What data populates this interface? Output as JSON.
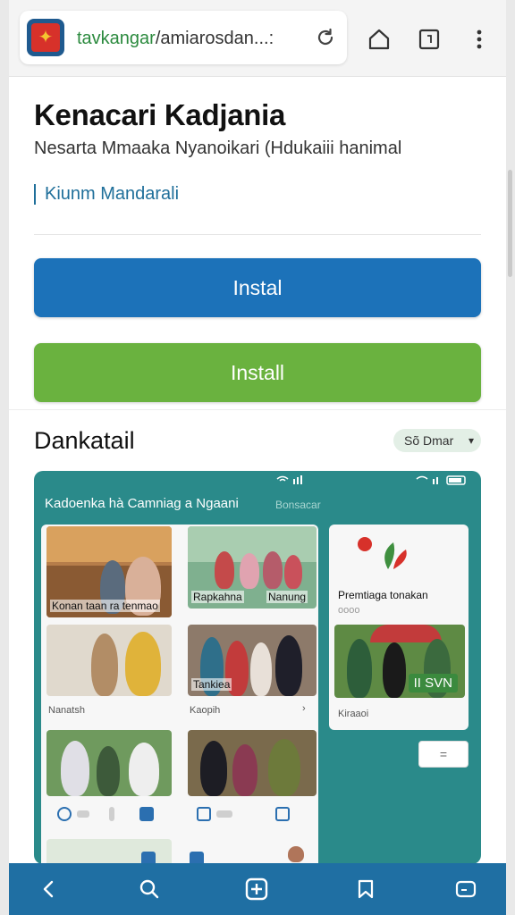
{
  "browser": {
    "url_host": "tavkangar",
    "url_path": "/amiarosdan...:",
    "icons": [
      "site-logo",
      "reload-icon",
      "home-icon",
      "tab-switcher-icon",
      "more-vertical-icon"
    ]
  },
  "page": {
    "title": "Kenacari Kadjania",
    "subtitle": "Nesarta Mmaaka Nyanoikari (Hdukaiii hanimal",
    "author": "Kiunm Mandarali"
  },
  "buttons": {
    "primary_label": "Instal",
    "secondary_label": "Install"
  },
  "section": {
    "title": "Dankatail",
    "pill_label": "Sõ Dmar",
    "pill_icon": "chevron-down-icon"
  },
  "preview": {
    "title": "Kadoenka hà Camniag a Ngaani",
    "sub": "Bonsacar",
    "tile_labels": [
      "Konan taan ra tenmao",
      "Rapkahna",
      "Nanung",
      "Tankiea",
      "Premtiaga tonakan"
    ],
    "captions": [
      "Nanatsh",
      "Kaopih",
      "Kiraaoi",
      "oooo"
    ],
    "badge": "II SVN",
    "side_button_icon": "equals-icon"
  },
  "bottom_nav": {
    "icons": [
      "back-icon",
      "search-icon",
      "add-tab-icon",
      "bookmark-icon",
      "tabs-icon"
    ]
  },
  "colors": {
    "primary_blue": "#1c72b9",
    "install_green": "#6ab23f",
    "teal": "#2a8a8a",
    "nav_blue": "#1f6fa3"
  }
}
